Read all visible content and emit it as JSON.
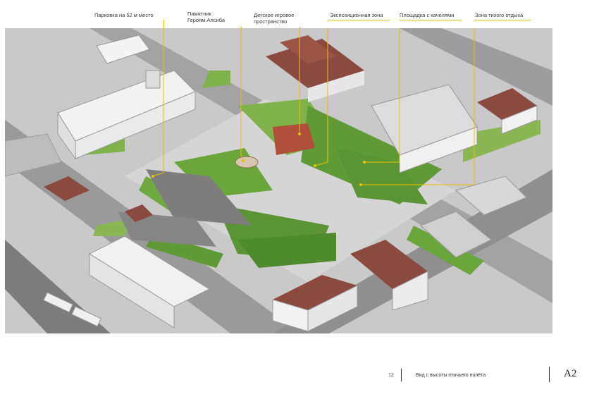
{
  "callouts": [
    {
      "id": "parking",
      "text": "Парковка на 52 м место"
    },
    {
      "id": "monument",
      "text": "Памятник\nГероям Алсиба"
    },
    {
      "id": "playground",
      "text": "Детское игровое\nпространство"
    },
    {
      "id": "exhibition",
      "text": "Экспозиционная зона"
    },
    {
      "id": "swings",
      "text": "Площадка с качелями"
    },
    {
      "id": "quiet",
      "text": "Зона тихого отдыха"
    }
  ],
  "footer": {
    "page_number": "12",
    "title": "Вид с высоты птичьего полёта",
    "sheet": "А2"
  },
  "colors": {
    "leader": "#e8c200",
    "grass": "#7fb24a",
    "tree": "#4f8a2e",
    "road": "#8c8c8c",
    "pavement": "#bdbdbd",
    "roof_red": "#8a4a3f",
    "playground": "#b0503a"
  }
}
